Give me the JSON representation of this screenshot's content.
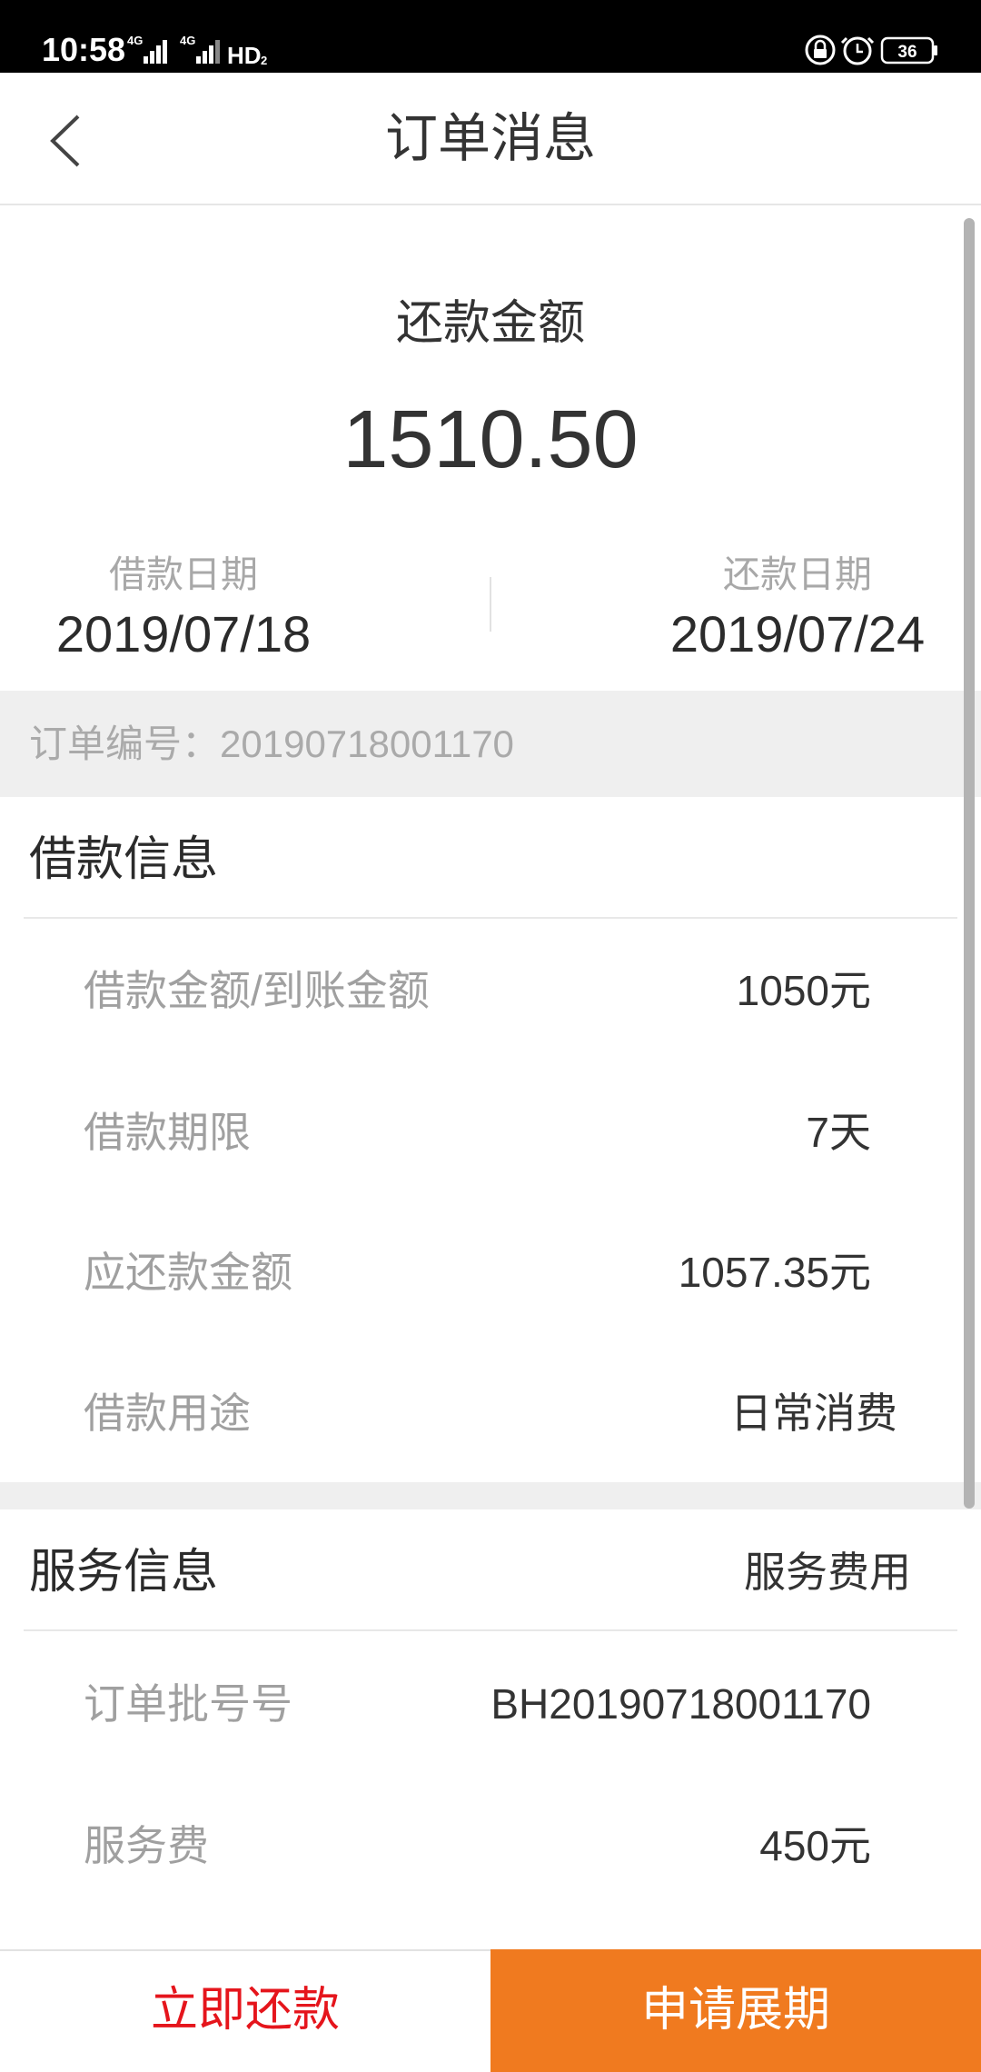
{
  "status_bar": {
    "time": "10:58",
    "network_1": "4G",
    "network_2": "4G",
    "hd": "HD",
    "hd_sim": "2",
    "battery": "36",
    "icons": [
      "signal-icon",
      "signal-icon",
      "hd-icon",
      "rotation-lock-icon",
      "alarm-icon",
      "battery-icon"
    ]
  },
  "header": {
    "title": "订单消息",
    "back_icon": "chevron-left-icon"
  },
  "summary": {
    "amount_label": "还款金额",
    "amount": "1510.50",
    "loan_date_label": "借款日期",
    "loan_date": "2019/07/18",
    "repay_date_label": "还款日期",
    "repay_date": "2019/07/24"
  },
  "order": {
    "label": "订单编号：",
    "number": "20190718001170"
  },
  "loan_info": {
    "title": "借款信息",
    "rows": [
      {
        "label": "借款金额/到账金额",
        "value": "1050元"
      },
      {
        "label": "借款期限",
        "value": "7天"
      },
      {
        "label": "应还款金额",
        "value": "1057.35元"
      },
      {
        "label": "借款用途",
        "value": "日常消费"
      }
    ]
  },
  "service_info": {
    "title": "服务信息",
    "fee_link": "服务费用",
    "rows": [
      {
        "label": "订单批号号",
        "value": "BH20190718001170"
      },
      {
        "label": "服务费",
        "value": "450元"
      }
    ]
  },
  "actions": {
    "repay_now": "立即还款",
    "apply_extension": "申请展期"
  },
  "colors": {
    "accent": "#f07a1f",
    "repay_text": "#e5151c",
    "label_gray": "#a0a0a0",
    "text_dark": "#333333",
    "band_gray": "#efefef"
  }
}
